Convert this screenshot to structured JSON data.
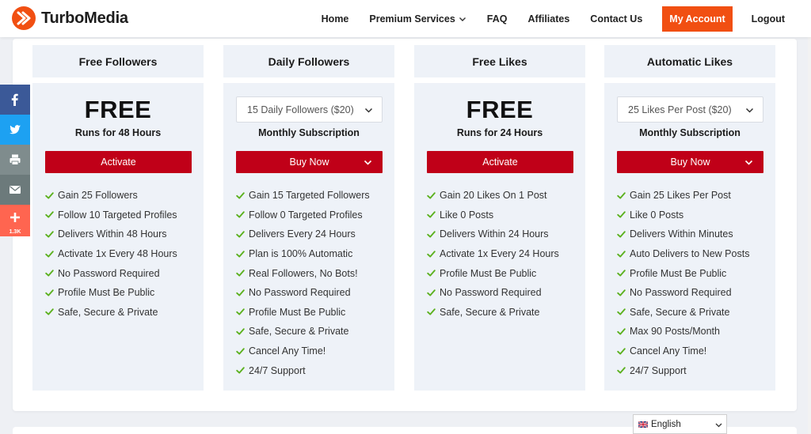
{
  "brand": {
    "name": "TurboMedia",
    "accent": "#f14f12",
    "button_red": "#c00018"
  },
  "nav": {
    "items": [
      "Home",
      "Premium Services",
      "FAQ",
      "Affiliates",
      "Contact Us"
    ],
    "account": "My Account",
    "logout": "Logout"
  },
  "share": {
    "count": "1.3K"
  },
  "columns": [
    {
      "title": "Free Followers",
      "price": "FREE",
      "subtitle": "Runs for 48 Hours",
      "button": "Activate",
      "features": [
        "Gain 25 Followers",
        "Follow 10 Targeted Profiles",
        "Delivers Within 48 Hours",
        "Activate 1x Every 48 Hours",
        "No Password Required",
        "Profile Must Be Public",
        "Safe, Secure & Private"
      ]
    },
    {
      "title": "Daily Followers",
      "select_value": "15 Daily Followers ($20)",
      "subtitle": "Monthly Subscription",
      "button": "Buy Now",
      "features": [
        "Gain 15 Targeted Followers",
        "Follow 0 Targeted Profiles",
        "Delivers Every 24 Hours",
        "Plan is 100% Automatic",
        "Real Followers, No Bots!",
        "No Password Required",
        "Profile Must Be Public",
        "Safe, Secure & Private",
        "Cancel Any Time!",
        "24/7 Support"
      ]
    },
    {
      "title": "Free Likes",
      "price": "FREE",
      "subtitle": "Runs for 24 Hours",
      "button": "Activate",
      "features": [
        "Gain 20 Likes On 1 Post",
        "Like 0 Posts",
        "Delivers Within 24 Hours",
        "Activate 1x Every 24 Hours",
        "Profile Must Be Public",
        "No Password Required",
        "Safe, Secure & Private"
      ]
    },
    {
      "title": "Automatic Likes",
      "select_value": "25 Likes Per Post ($20)",
      "subtitle": "Monthly Subscription",
      "button": "Buy Now",
      "features": [
        "Gain 25 Likes Per Post",
        "Like 0 Posts",
        "Delivers Within Minutes",
        "Auto Delivers to New Posts",
        "Profile Must Be Public",
        "No Password Required",
        "Safe, Secure & Private",
        "Max 90 Posts/Month",
        "Cancel Any Time!",
        "24/7 Support"
      ]
    }
  ],
  "language": {
    "selected": "English"
  }
}
